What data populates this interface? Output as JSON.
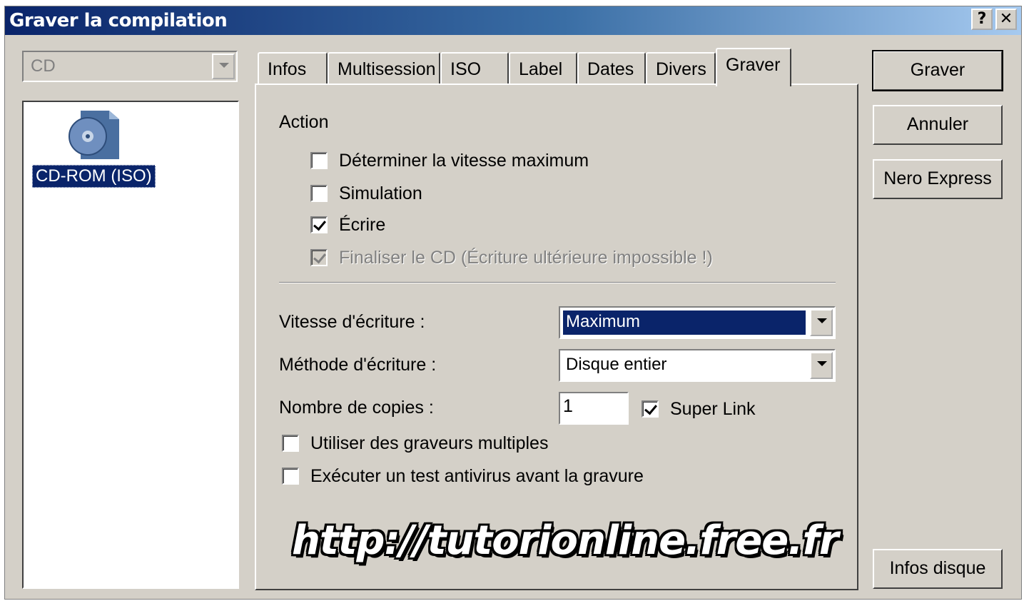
{
  "window": {
    "title": "Graver la compilation",
    "help_glyph": "?",
    "close_glyph": "✕"
  },
  "media_combo": {
    "value": "CD"
  },
  "compilation_list": {
    "items": [
      {
        "label": "CD-ROM (ISO)",
        "icon": "cd-rom-iso-icon"
      }
    ]
  },
  "tabs": [
    {
      "label": "Infos"
    },
    {
      "label": "Multisession"
    },
    {
      "label": "ISO"
    },
    {
      "label": "Label"
    },
    {
      "label": "Dates"
    },
    {
      "label": "Divers"
    },
    {
      "label": "Graver",
      "active": true
    }
  ],
  "burn_tab": {
    "action_heading": "Action",
    "options": [
      {
        "label": "Déterminer la vitesse maximum",
        "checked": false,
        "enabled": true
      },
      {
        "label": "Simulation",
        "checked": false,
        "enabled": true
      },
      {
        "label": "Écrire",
        "checked": true,
        "enabled": true
      },
      {
        "label": "Finaliser le CD (Écriture ultérieure impossible !)",
        "checked": true,
        "enabled": false
      }
    ],
    "write_speed": {
      "label": "Vitesse d'écriture :",
      "value": "Maximum"
    },
    "write_method": {
      "label": "Méthode d'écriture :",
      "value": "Disque entier"
    },
    "copies": {
      "label": "Nombre de copies :",
      "value": "1"
    },
    "super_link": {
      "label": "Super Link",
      "checked": true
    },
    "multiple_burners": {
      "label": "Utiliser des graveurs multiples",
      "checked": false
    },
    "antivirus": {
      "label": "Exécuter un test antivirus avant la gravure",
      "checked": false
    }
  },
  "watermark": "http://tutorionline.free.fr",
  "buttons": {
    "burn": "Graver",
    "cancel": "Annuler",
    "nero_express": "Nero Express",
    "disc_info": "Infos disque"
  },
  "colors": {
    "selection": "#0a246a",
    "dialog_face": "#d4d0c8"
  }
}
